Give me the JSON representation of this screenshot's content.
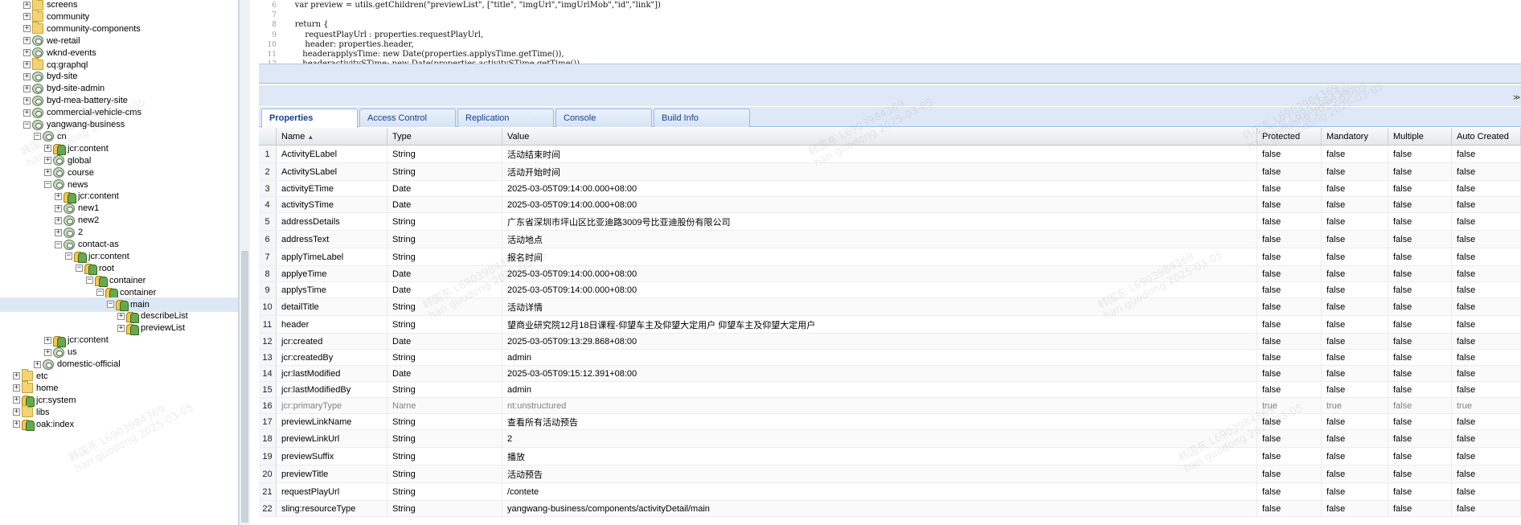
{
  "tree": [
    {
      "label": "screens",
      "icon": "folder-icon",
      "indent": 1,
      "toggle": "+"
    },
    {
      "label": "community",
      "icon": "folder-icon",
      "indent": 1,
      "toggle": "+"
    },
    {
      "label": "community-components",
      "icon": "folder-icon",
      "indent": 1,
      "toggle": "+"
    },
    {
      "label": "we-retail",
      "icon": "node-icon",
      "indent": 1,
      "toggle": "+"
    },
    {
      "label": "wknd-events",
      "icon": "node-icon",
      "indent": 1,
      "toggle": "+"
    },
    {
      "label": "cq:graphql",
      "icon": "folder-icon",
      "indent": 1,
      "toggle": "+"
    },
    {
      "label": "byd-site",
      "icon": "node-icon",
      "indent": 1,
      "toggle": "+"
    },
    {
      "label": "byd-site-admin",
      "icon": "node-icon",
      "indent": 1,
      "toggle": "+"
    },
    {
      "label": "byd-mea-battery-site",
      "icon": "node-icon",
      "indent": 1,
      "toggle": "+"
    },
    {
      "label": "commercial-vehicle-cms",
      "icon": "node-icon",
      "indent": 1,
      "toggle": "+"
    },
    {
      "label": "yangwang-business",
      "icon": "node-icon",
      "indent": 1,
      "toggle": "-"
    },
    {
      "label": "cn",
      "icon": "node-icon",
      "indent": 2,
      "toggle": "-"
    },
    {
      "label": "jcr:content",
      "icon": "component-icon",
      "indent": 3,
      "toggle": "+"
    },
    {
      "label": "global",
      "icon": "node-icon",
      "indent": 3,
      "toggle": "+"
    },
    {
      "label": "course",
      "icon": "node-icon",
      "indent": 3,
      "toggle": "+"
    },
    {
      "label": "news",
      "icon": "node-icon",
      "indent": 3,
      "toggle": "-"
    },
    {
      "label": "jcr:content",
      "icon": "component-icon",
      "indent": 4,
      "toggle": "+"
    },
    {
      "label": "new1",
      "icon": "node-icon",
      "indent": 4,
      "toggle": "+"
    },
    {
      "label": "new2",
      "icon": "node-icon",
      "indent": 4,
      "toggle": "+"
    },
    {
      "label": "2",
      "icon": "node-icon",
      "indent": 4,
      "toggle": "+"
    },
    {
      "label": "contact-as",
      "icon": "node-icon",
      "indent": 4,
      "toggle": "-"
    },
    {
      "label": "jcr:content",
      "icon": "component-icon",
      "indent": 5,
      "toggle": "-"
    },
    {
      "label": "root",
      "icon": "component-icon",
      "indent": 6,
      "toggle": "-"
    },
    {
      "label": "container",
      "icon": "component-icon",
      "indent": 7,
      "toggle": "-"
    },
    {
      "label": "container",
      "icon": "component-icon",
      "indent": 8,
      "toggle": "-"
    },
    {
      "label": "main",
      "icon": "component-icon",
      "indent": 9,
      "toggle": "-",
      "selected": true
    },
    {
      "label": "describeList",
      "icon": "component-icon",
      "indent": 10,
      "toggle": "+"
    },
    {
      "label": "previewList",
      "icon": "component-icon",
      "indent": 10,
      "toggle": "+"
    },
    {
      "label": "jcr:content",
      "icon": "component-icon",
      "indent": 3,
      "toggle": "+"
    },
    {
      "label": "us",
      "icon": "node-icon",
      "indent": 3,
      "toggle": "+"
    },
    {
      "label": "domestic-official",
      "icon": "node-icon",
      "indent": 2,
      "toggle": "+"
    },
    {
      "label": "etc",
      "icon": "folder-icon",
      "indent": 0,
      "toggle": "+"
    },
    {
      "label": "home",
      "icon": "folder-icon",
      "indent": 0,
      "toggle": "+"
    },
    {
      "label": "jcr:system",
      "icon": "component-icon",
      "indent": 0,
      "toggle": "+"
    },
    {
      "label": "libs",
      "icon": "folder-icon",
      "indent": 0,
      "toggle": "+"
    },
    {
      "label": "oak:index",
      "icon": "component-icon",
      "indent": 0,
      "toggle": "+"
    }
  ],
  "code_lines": [
    {
      "n": "6",
      "text": "    var preview = utils.getChildren(\"previewList\", [\"title\", \"imgUrl\",\"imgUrlMob\",\"id\",\"link\"])"
    },
    {
      "n": "7",
      "text": ""
    },
    {
      "n": "8",
      "text": "    return {"
    },
    {
      "n": "9",
      "text": "        requestPlayUrl : properties.requestPlayUrl,"
    },
    {
      "n": "10",
      "text": "        header: properties.header,"
    },
    {
      "n": "11",
      "text": "       headerapplysTime: new Date(properties.applysTime.getTime()),"
    },
    {
      "n": "12",
      "text": "       headeractivitySTime: new Date(properties.activitySTime.getTime()),"
    }
  ],
  "tabs": [
    "Properties",
    "Access Control",
    "Replication",
    "Console",
    "Build Info"
  ],
  "active_tab": "Properties",
  "columns": [
    "Name",
    "Type",
    "Value",
    "Protected",
    "Mandatory",
    "Multiple",
    "Auto Created"
  ],
  "rows": [
    [
      "1",
      "ActivityELabel",
      "String",
      "活动结束时间",
      "false",
      "false",
      "false",
      "false"
    ],
    [
      "2",
      "ActivitySLabel",
      "String",
      "活动开始时间",
      "false",
      "false",
      "false",
      "false"
    ],
    [
      "3",
      "activityETime",
      "Date",
      "2025-03-05T09:14:00.000+08:00",
      "false",
      "false",
      "false",
      "false"
    ],
    [
      "4",
      "activitySTime",
      "Date",
      "2025-03-05T09:14:00.000+08:00",
      "false",
      "false",
      "false",
      "false"
    ],
    [
      "5",
      "addressDetails",
      "String",
      "广东省深圳市坪山区比亚迪路3009号比亚迪股份有限公司",
      "false",
      "false",
      "false",
      "false"
    ],
    [
      "6",
      "addressText",
      "String",
      "活动地点",
      "false",
      "false",
      "false",
      "false"
    ],
    [
      "7",
      "applyTimeLabel",
      "String",
      "报名时间",
      "false",
      "false",
      "false",
      "false"
    ],
    [
      "8",
      "applyeTime",
      "Date",
      "2025-03-05T09:14:00.000+08:00",
      "false",
      "false",
      "false",
      "false"
    ],
    [
      "9",
      "applysTime",
      "Date",
      "2025-03-05T09:14:00.000+08:00",
      "false",
      "false",
      "false",
      "false"
    ],
    [
      "10",
      "detailTitle",
      "String",
      "活动详情",
      "false",
      "false",
      "false",
      "false"
    ],
    [
      "11",
      "header",
      "String",
      "望商业研究院12月18日课程-仰望车主及仰望大定用户 仰望车主及仰望大定用户",
      "false",
      "false",
      "false",
      "false"
    ],
    [
      "12",
      "jcr:created",
      "Date",
      "2025-03-05T09:13:29.868+08:00",
      "false",
      "false",
      "false",
      "false"
    ],
    [
      "13",
      "jcr:createdBy",
      "String",
      "admin",
      "false",
      "false",
      "false",
      "false"
    ],
    [
      "14",
      "jcr:lastModified",
      "Date",
      "2025-03-05T09:15:12.391+08:00",
      "false",
      "false",
      "false",
      "false"
    ],
    [
      "15",
      "jcr:lastModifiedBy",
      "String",
      "admin",
      "false",
      "false",
      "false",
      "false"
    ],
    [
      "16",
      "jcr:primaryType",
      "Name",
      "nt:unstructured",
      "true",
      "true",
      "false",
      "true"
    ],
    [
      "17",
      "previewLinkName",
      "String",
      "查看所有活动预告",
      "false",
      "false",
      "false",
      "false"
    ],
    [
      "18",
      "previewLinkUrl",
      "String",
      "2",
      "false",
      "false",
      "false",
      "false"
    ],
    [
      "19",
      "previewSuffix",
      "String",
      "播放",
      "false",
      "false",
      "false",
      "false"
    ],
    [
      "20",
      "previewTitle",
      "String",
      "活动预告",
      "false",
      "false",
      "false",
      "false"
    ],
    [
      "21",
      "requestPlayUrl",
      "String",
      "/contete",
      "false",
      "false",
      "false",
      "false"
    ],
    [
      "22",
      "sling:resourceType",
      "String",
      "yangwang-business/components/activityDetail/main",
      "false",
      "false",
      "false",
      "false"
    ]
  ],
  "watermark_text": "韩国东 L6903984369",
  "watermark_sub": "han guodong 2025-03-05"
}
